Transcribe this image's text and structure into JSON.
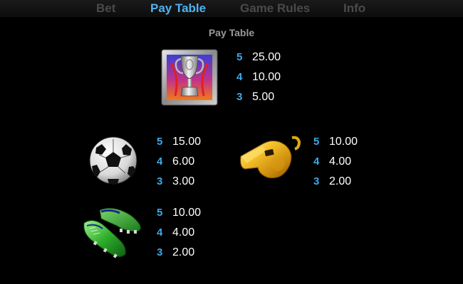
{
  "tabs": {
    "bet": "Bet",
    "pay_table": "Pay Table",
    "game_rules": "Game Rules",
    "info": "Info"
  },
  "active_tab": "Pay Table",
  "subtitle": "Pay Table",
  "symbols": {
    "trophy": {
      "icon": "trophy-icon",
      "payouts": [
        {
          "count": "5",
          "value": "25.00"
        },
        {
          "count": "4",
          "value": "10.00"
        },
        {
          "count": "3",
          "value": "5.00"
        }
      ]
    },
    "ball": {
      "icon": "soccer-ball-icon",
      "payouts": [
        {
          "count": "5",
          "value": "15.00"
        },
        {
          "count": "4",
          "value": "6.00"
        },
        {
          "count": "3",
          "value": "3.00"
        }
      ]
    },
    "whistle": {
      "icon": "whistle-icon",
      "payouts": [
        {
          "count": "5",
          "value": "10.00"
        },
        {
          "count": "4",
          "value": "4.00"
        },
        {
          "count": "3",
          "value": "2.00"
        }
      ]
    },
    "boots": {
      "icon": "football-boots-icon",
      "payouts": [
        {
          "count": "5",
          "value": "10.00"
        },
        {
          "count": "4",
          "value": "4.00"
        },
        {
          "count": "3",
          "value": "2.00"
        }
      ]
    }
  },
  "colors": {
    "active_tab": "#4fb3ef",
    "inactive_tab": "#4a4a4a",
    "count": "#3fa9e8",
    "value": "#ffffff",
    "background": "#000000"
  }
}
